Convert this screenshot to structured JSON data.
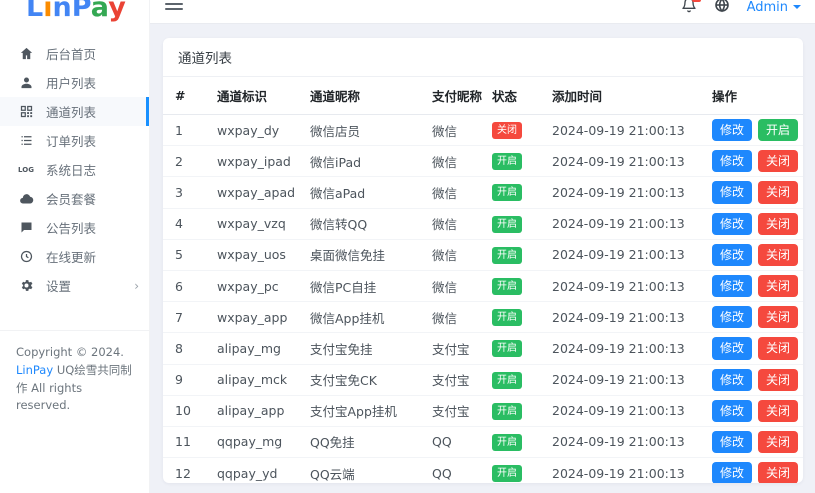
{
  "brand": {
    "letters": [
      {
        "char": "L",
        "color": "#4285f4"
      },
      {
        "char": "i",
        "color": "#fb8c00"
      },
      {
        "char": "n",
        "color": "#4285f4"
      },
      {
        "char": "P",
        "color": "#4285f4"
      },
      {
        "char": "a",
        "color": "#34a853"
      },
      {
        "char": "y",
        "color": "#ea4335"
      }
    ]
  },
  "sidebar": {
    "items": [
      {
        "label": "后台首页",
        "icon": "home-icon",
        "active": false,
        "expandable": false
      },
      {
        "label": "用户列表",
        "icon": "user-icon",
        "active": false,
        "expandable": false
      },
      {
        "label": "通道列表",
        "icon": "channels-icon",
        "active": true,
        "expandable": false
      },
      {
        "label": "订单列表",
        "icon": "orders-icon",
        "active": false,
        "expandable": false
      },
      {
        "label": "系统日志",
        "icon": "log-icon",
        "active": false,
        "expandable": false
      },
      {
        "label": "会员套餐",
        "icon": "cloud-icon",
        "active": false,
        "expandable": false
      },
      {
        "label": "公告列表",
        "icon": "announcement-icon",
        "active": false,
        "expandable": false
      },
      {
        "label": "在线更新",
        "icon": "update-icon",
        "active": false,
        "expandable": false
      },
      {
        "label": "设置",
        "icon": "settings-icon",
        "active": false,
        "expandable": true
      }
    ],
    "copyright": {
      "prefix": "Copyright © 2024. ",
      "brand_link": "LinPay",
      "suffix": " UQ绘雪共同制作 All rights reserved."
    }
  },
  "topbar": {
    "user_menu": "Admin"
  },
  "main": {
    "card_title": "通道列表",
    "table": {
      "headers": [
        "#",
        "通道标识",
        "通道昵称",
        "支付昵称",
        "状态",
        "添加时间",
        "操作"
      ],
      "rows": [
        {
          "num": "1",
          "id": "wxpay_dy",
          "nick": "微信店员",
          "pay": "微信",
          "status": "关闭",
          "status_type": "closed",
          "time": "2024-09-19 21:00:13",
          "actions": [
            {
              "label": "修改",
              "style": "primary",
              "name": "edit-button"
            },
            {
              "label": "开启",
              "style": "success",
              "name": "enable-button"
            }
          ]
        },
        {
          "num": "2",
          "id": "wxpay_ipad",
          "nick": "微信iPad",
          "pay": "微信",
          "status": "开启",
          "status_type": "open",
          "time": "2024-09-19 21:00:13",
          "actions": [
            {
              "label": "修改",
              "style": "primary",
              "name": "edit-button"
            },
            {
              "label": "关闭",
              "style": "danger",
              "name": "disable-button"
            }
          ]
        },
        {
          "num": "3",
          "id": "wxpay_apad",
          "nick": "微信aPad",
          "pay": "微信",
          "status": "开启",
          "status_type": "open",
          "time": "2024-09-19 21:00:13",
          "actions": [
            {
              "label": "修改",
              "style": "primary",
              "name": "edit-button"
            },
            {
              "label": "关闭",
              "style": "danger",
              "name": "disable-button"
            }
          ]
        },
        {
          "num": "4",
          "id": "wxpay_vzq",
          "nick": "微信转QQ",
          "pay": "微信",
          "status": "开启",
          "status_type": "open",
          "time": "2024-09-19 21:00:13",
          "actions": [
            {
              "label": "修改",
              "style": "primary",
              "name": "edit-button"
            },
            {
              "label": "关闭",
              "style": "danger",
              "name": "disable-button"
            }
          ]
        },
        {
          "num": "5",
          "id": "wxpay_uos",
          "nick": "桌面微信免挂",
          "pay": "微信",
          "status": "开启",
          "status_type": "open",
          "time": "2024-09-19 21:00:13",
          "actions": [
            {
              "label": "修改",
              "style": "primary",
              "name": "edit-button"
            },
            {
              "label": "关闭",
              "style": "danger",
              "name": "disable-button"
            }
          ]
        },
        {
          "num": "6",
          "id": "wxpay_pc",
          "nick": "微信PC自挂",
          "pay": "微信",
          "status": "开启",
          "status_type": "open",
          "time": "2024-09-19 21:00:13",
          "actions": [
            {
              "label": "修改",
              "style": "primary",
              "name": "edit-button"
            },
            {
              "label": "关闭",
              "style": "danger",
              "name": "disable-button"
            }
          ]
        },
        {
          "num": "7",
          "id": "wxpay_app",
          "nick": "微信App挂机",
          "pay": "微信",
          "status": "开启",
          "status_type": "open",
          "time": "2024-09-19 21:00:13",
          "actions": [
            {
              "label": "修改",
              "style": "primary",
              "name": "edit-button"
            },
            {
              "label": "关闭",
              "style": "danger",
              "name": "disable-button"
            }
          ]
        },
        {
          "num": "8",
          "id": "alipay_mg",
          "nick": "支付宝免挂",
          "pay": "支付宝",
          "status": "开启",
          "status_type": "open",
          "time": "2024-09-19 21:00:13",
          "actions": [
            {
              "label": "修改",
              "style": "primary",
              "name": "edit-button"
            },
            {
              "label": "关闭",
              "style": "danger",
              "name": "disable-button"
            }
          ]
        },
        {
          "num": "9",
          "id": "alipay_mck",
          "nick": "支付宝免CK",
          "pay": "支付宝",
          "status": "开启",
          "status_type": "open",
          "time": "2024-09-19 21:00:13",
          "actions": [
            {
              "label": "修改",
              "style": "primary",
              "name": "edit-button"
            },
            {
              "label": "关闭",
              "style": "danger",
              "name": "disable-button"
            }
          ]
        },
        {
          "num": "10",
          "id": "alipay_app",
          "nick": "支付宝App挂机",
          "pay": "支付宝",
          "status": "开启",
          "status_type": "open",
          "time": "2024-09-19 21:00:13",
          "actions": [
            {
              "label": "修改",
              "style": "primary",
              "name": "edit-button"
            },
            {
              "label": "关闭",
              "style": "danger",
              "name": "disable-button"
            }
          ]
        },
        {
          "num": "11",
          "id": "qqpay_mg",
          "nick": "QQ免挂",
          "pay": "QQ",
          "status": "开启",
          "status_type": "open",
          "time": "2024-09-19 21:00:13",
          "actions": [
            {
              "label": "修改",
              "style": "primary",
              "name": "edit-button"
            },
            {
              "label": "关闭",
              "style": "danger",
              "name": "disable-button"
            }
          ]
        },
        {
          "num": "12",
          "id": "qqpay_yd",
          "nick": "QQ云端",
          "pay": "QQ",
          "status": "开启",
          "status_type": "open",
          "time": "2024-09-19 21:00:13",
          "actions": [
            {
              "label": "修改",
              "style": "primary",
              "name": "edit-button"
            },
            {
              "label": "关闭",
              "style": "danger",
              "name": "disable-button"
            }
          ]
        }
      ]
    }
  },
  "colors": {
    "accent_blue": "#1e88fd",
    "success_green": "#2abd63",
    "danger_red": "#f5493e",
    "active_indicator": "#1890ff",
    "content_background": "#eff1f7"
  }
}
